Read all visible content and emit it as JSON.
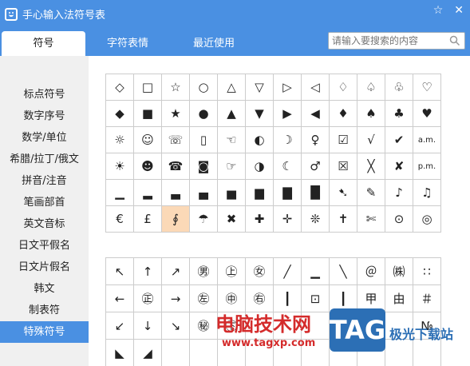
{
  "window": {
    "title": "手心输入法符号表",
    "pin_icon": "☆",
    "close_icon": "✕"
  },
  "tabs": [
    {
      "label": "符号",
      "active": true
    },
    {
      "label": "字符表情",
      "active": false
    },
    {
      "label": "最近使用",
      "active": false
    }
  ],
  "search": {
    "placeholder": "请输入要搜索的内容"
  },
  "sidebar": {
    "items": [
      {
        "label": "标点符号"
      },
      {
        "label": "数字序号"
      },
      {
        "label": "数学/单位"
      },
      {
        "label": "希腊/拉丁/俄文"
      },
      {
        "label": "拼音/注音"
      },
      {
        "label": "笔画部首"
      },
      {
        "label": "英文音标"
      },
      {
        "label": "日文平假名"
      },
      {
        "label": "日文片假名"
      },
      {
        "label": "韩文"
      },
      {
        "label": "制表符"
      },
      {
        "label": "特殊符号",
        "active": true
      }
    ]
  },
  "grid1": {
    "selected_index": 62,
    "rows": [
      [
        "◇",
        "□",
        "☆",
        "○",
        "△",
        "▽",
        "▷",
        "◁",
        "♢",
        "♤",
        "♧",
        "♡"
      ],
      [
        "◆",
        "■",
        "★",
        "●",
        "▲",
        "▼",
        "▶",
        "◀",
        "♦",
        "♠",
        "♣",
        "♥"
      ],
      [
        "☼",
        "☺",
        "☏",
        "▯",
        "☜",
        "◐",
        "☽",
        "♀",
        "☑",
        "√",
        "✔",
        "a.m."
      ],
      [
        "☀",
        "☻",
        "☎",
        "◙",
        "☞",
        "◑",
        "☾",
        "♂",
        "☒",
        "╳",
        "✘",
        "p.m."
      ],
      [
        "▁",
        "▂",
        "▃",
        "▄",
        "▅",
        "▆",
        "▇",
        "█",
        "➷",
        "✎",
        "♪",
        "♫"
      ],
      [
        "€",
        "£",
        "∮",
        "☂",
        "✖",
        "✚",
        "✛",
        "❊",
        "✝",
        "✄",
        "⊙",
        "◎"
      ]
    ]
  },
  "grid2": {
    "rows": [
      [
        "↖",
        "↑",
        "↗",
        "㊚",
        "㊤",
        "㊛",
        "╱",
        "▁",
        "╲",
        "＠",
        "㈱",
        "∷"
      ],
      [
        "←",
        "㊣",
        "→",
        "㊧",
        "㊥",
        "㊨",
        "┃",
        "⊡",
        "┃",
        "甲",
        "由",
        "＃"
      ],
      [
        "↙",
        "↓",
        "↘",
        "㊙",
        "㊦",
        "",
        "",
        "",
        "",
        "",
        "",
        "№"
      ],
      [
        "◣",
        "◢",
        "",
        "",
        "",
        "",
        "",
        "",
        "",
        "",
        "",
        ""
      ]
    ]
  },
  "watermark": {
    "text": "电脑技术网",
    "url": "www.tagxp.com",
    "badge": "TAG",
    "suffix": "极光下载站"
  }
}
